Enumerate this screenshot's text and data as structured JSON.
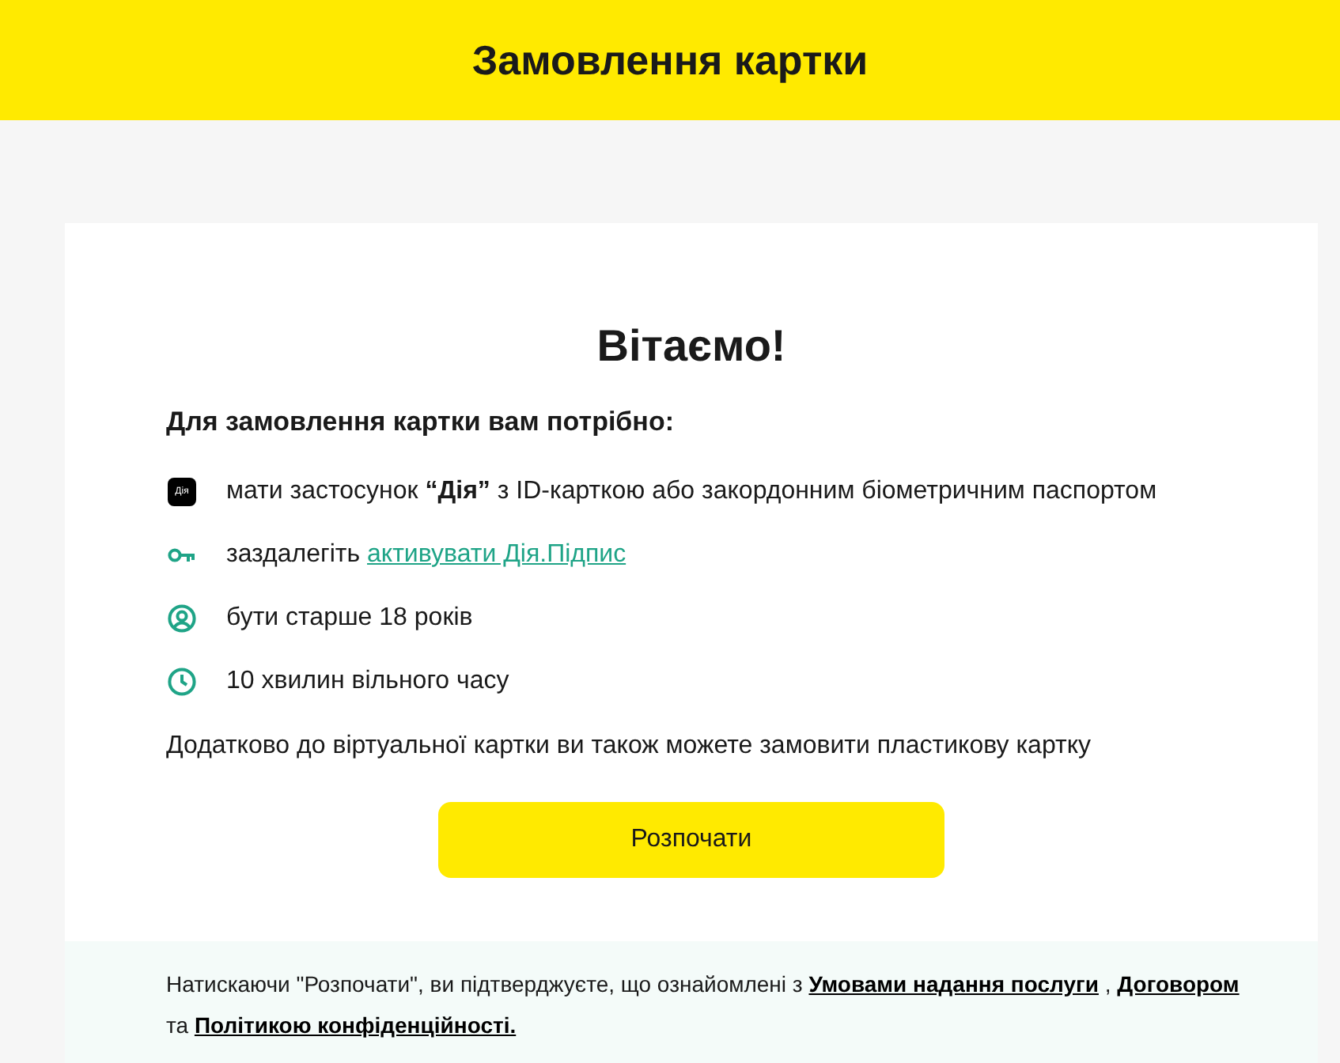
{
  "header": {
    "title": "Замовлення картки"
  },
  "card": {
    "title": "Вітаємо!",
    "subtitle": "Для замовлення картки вам потрібно:",
    "requirements": [
      {
        "kind": "app-logo",
        "icon_text": "Дія",
        "parts": [
          {
            "kind": "text",
            "text": "мати застосунок **“Дія”** з ID-карткою або закордонним біометричним паспортом"
          }
        ]
      },
      {
        "kind": "key",
        "parts": [
          {
            "kind": "text",
            "text": "заздалегіть "
          },
          {
            "kind": "link",
            "text": "активувати Дія.Підпис"
          }
        ]
      },
      {
        "kind": "user",
        "parts": [
          {
            "kind": "text",
            "text": "бути старше 18 років"
          }
        ]
      },
      {
        "kind": "clock",
        "parts": [
          {
            "kind": "text",
            "text": "10 хвилин вільного часу"
          }
        ]
      }
    ],
    "note": "Додатково до віртуальної картки ви також можете замовити пластикову картку",
    "button": "Розпочати",
    "footer": [
      {
        "kind": "text",
        "text": "Натискаючи \"Розпочати\", ви підтверджуєте, що ознайомлені з "
      },
      {
        "kind": "link",
        "text": "Умовами надання послуги"
      },
      {
        "kind": "text",
        "text": " , "
      },
      {
        "kind": "link",
        "text": "Договором"
      },
      {
        "kind": "text",
        "text": " та "
      },
      {
        "kind": "link",
        "text": "Політикою конфіденційності."
      }
    ]
  }
}
